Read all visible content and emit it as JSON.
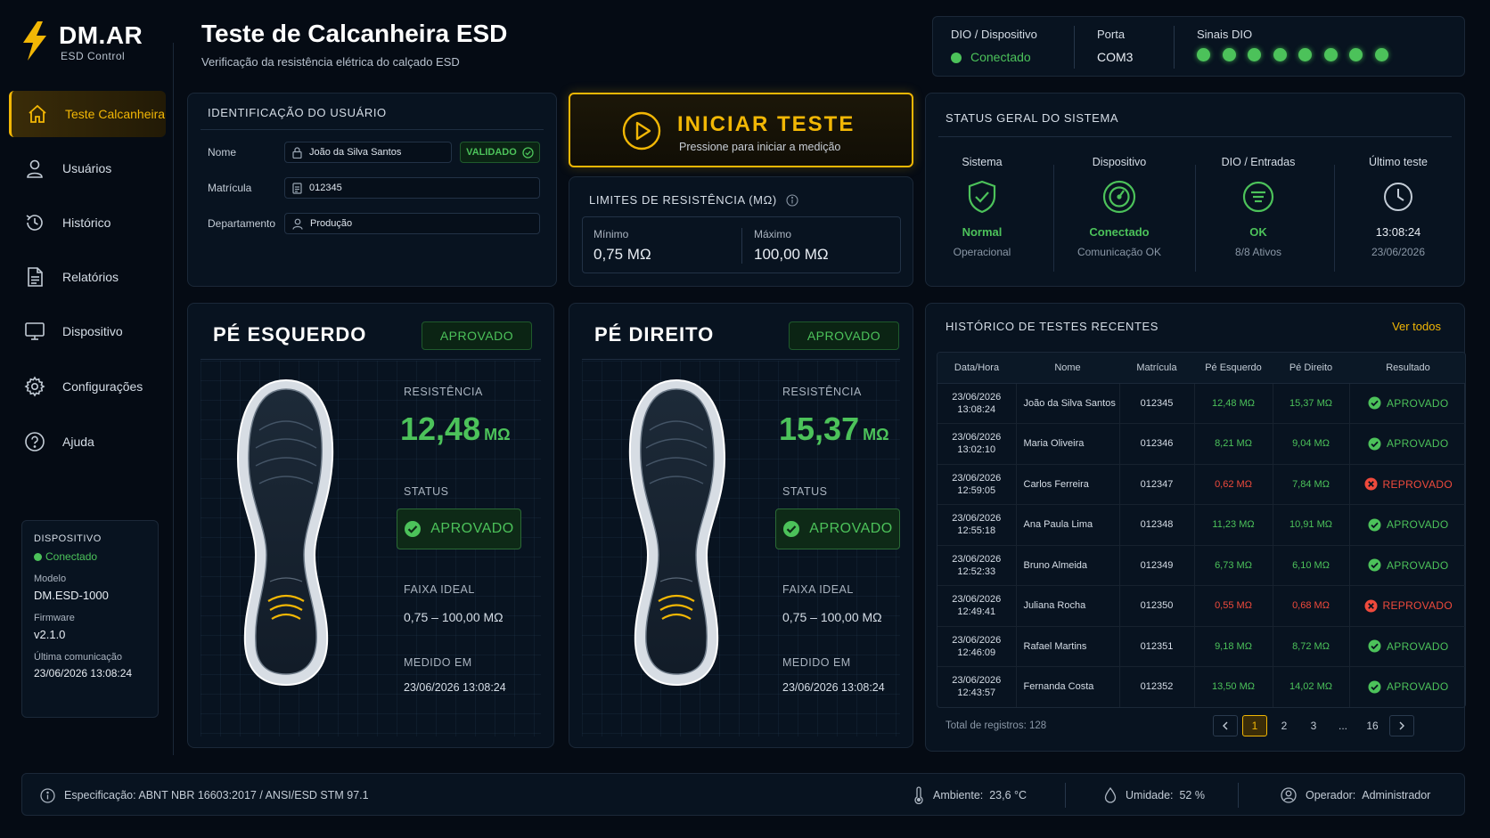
{
  "brand": {
    "name": "DM.AR",
    "sub": "ESD Control"
  },
  "nav": [
    {
      "label": "Teste Calcanheira",
      "icon": "home-icon",
      "active": true
    },
    {
      "label": "Usuários",
      "icon": "user-icon"
    },
    {
      "label": "Histórico",
      "icon": "history-icon"
    },
    {
      "label": "Relatórios",
      "icon": "report-icon"
    },
    {
      "label": "Dispositivo",
      "icon": "monitor-icon"
    },
    {
      "label": "Configurações",
      "icon": "gear-icon"
    },
    {
      "label": "Ajuda",
      "icon": "help-icon"
    }
  ],
  "device_card": {
    "title": "DISPOSITIVO",
    "status": "Conectado",
    "model_label": "Modelo",
    "model": "DM.ESD-1000",
    "firmware_label": "Firmware",
    "firmware": "v2.1.0",
    "last_comm_label": "Última comunicação",
    "last_comm": "23/06/2026 13:08:24"
  },
  "header": {
    "title": "Teste de Calcanheira ESD",
    "subtitle": "Verificação da resistência elétrica do calçado ESD"
  },
  "connection": {
    "dio_label": "DIO / Dispositivo",
    "dio_status": "Conectado",
    "port_label": "Porta",
    "port": "COM3",
    "signals_label": "Sinais DIO",
    "signals_active": 8
  },
  "user": {
    "section_title": "IDENTIFICAÇÃO DO USUÁRIO",
    "name_label": "Nome",
    "name": "João da Silva Santos",
    "validated": "VALIDADO",
    "id_label": "Matrícula",
    "id": "012345",
    "dept_label": "Departamento",
    "dept": "Produção"
  },
  "start": {
    "title": "INICIAR TESTE",
    "subtitle": "Pressione para iniciar a medição"
  },
  "limits": {
    "title": "LIMITES DE RESISTÊNCIA (MΩ)",
    "min_label": "Mínimo",
    "min": "0,75 MΩ",
    "max_label": "Máximo",
    "max": "100,00 MΩ"
  },
  "system": {
    "title": "STATUS GERAL DO SISTEMA",
    "cols": [
      {
        "title": "Sistema",
        "value": "Normal",
        "sub": "Operacional",
        "icon": "shield-check-icon"
      },
      {
        "title": "Dispositivo",
        "value": "Conectado",
        "sub": "Comunicação OK",
        "icon": "gauge-icon"
      },
      {
        "title": "DIO / Entradas",
        "value": "OK",
        "sub": "8/8 Ativos",
        "icon": "list-circle-icon"
      },
      {
        "title": "Último teste",
        "value": "13:08:24",
        "sub": "23/06/2026",
        "icon": "clock-icon"
      }
    ]
  },
  "left_foot": {
    "title": "PÉ ESQUERDO",
    "badge": "APROVADO",
    "resistance_label": "RESISTÊNCIA",
    "resistance": "12,48",
    "unit": "MΩ",
    "status_label": "STATUS",
    "status": "APROVADO",
    "range_label": "FAIXA IDEAL",
    "range": "0,75 – 100,00 MΩ",
    "measured_label": "MEDIDO EM",
    "measured": "23/06/2026 13:08:24"
  },
  "right_foot": {
    "title": "PÉ DIREITO",
    "badge": "APROVADO",
    "resistance_label": "RESISTÊNCIA",
    "resistance": "15,37",
    "unit": "MΩ",
    "status_label": "STATUS",
    "status": "APROVADO",
    "range_label": "FAIXA IDEAL",
    "range": "0,75 – 100,00 MΩ",
    "measured_label": "MEDIDO EM",
    "measured": "23/06/2026 13:08:24"
  },
  "history": {
    "title": "HISTÓRICO DE TESTES RECENTES",
    "view_all": "Ver todos",
    "columns": [
      "Data/Hora",
      "Nome",
      "Matrícula",
      "Pé Esquerdo",
      "Pé Direito",
      "Resultado"
    ],
    "rows": [
      {
        "date": "23/06/2026",
        "time": "13:08:24",
        "name": "João da Silva Santos",
        "id": "012345",
        "left": "12,48 MΩ",
        "right": "15,37 MΩ",
        "left_ok": true,
        "right_ok": true,
        "result": "APROVADO",
        "ok": true
      },
      {
        "date": "23/06/2026",
        "time": "13:02:10",
        "name": "Maria Oliveira",
        "id": "012346",
        "left": "8,21 MΩ",
        "right": "9,04 MΩ",
        "left_ok": true,
        "right_ok": true,
        "result": "APROVADO",
        "ok": true
      },
      {
        "date": "23/06/2026",
        "time": "12:59:05",
        "name": "Carlos Ferreira",
        "id": "012347",
        "left": "0,62 MΩ",
        "right": "7,84 MΩ",
        "left_ok": false,
        "right_ok": true,
        "result": "REPROVADO",
        "ok": false
      },
      {
        "date": "23/06/2026",
        "time": "12:55:18",
        "name": "Ana Paula Lima",
        "id": "012348",
        "left": "11,23 MΩ",
        "right": "10,91 MΩ",
        "left_ok": true,
        "right_ok": true,
        "result": "APROVADO",
        "ok": true
      },
      {
        "date": "23/06/2026",
        "time": "12:52:33",
        "name": "Bruno Almeida",
        "id": "012349",
        "left": "6,73 MΩ",
        "right": "6,10 MΩ",
        "left_ok": true,
        "right_ok": true,
        "result": "APROVADO",
        "ok": true
      },
      {
        "date": "23/06/2026",
        "time": "12:49:41",
        "name": "Juliana Rocha",
        "id": "012350",
        "left": "0,55 MΩ",
        "right": "0,68 MΩ",
        "left_ok": false,
        "right_ok": false,
        "result": "REPROVADO",
        "ok": false
      },
      {
        "date": "23/06/2026",
        "time": "12:46:09",
        "name": "Rafael Martins",
        "id": "012351",
        "left": "9,18 MΩ",
        "right": "8,72 MΩ",
        "left_ok": true,
        "right_ok": true,
        "result": "APROVADO",
        "ok": true
      },
      {
        "date": "23/06/2026",
        "time": "12:43:57",
        "name": "Fernanda Costa",
        "id": "012352",
        "left": "13,50 MΩ",
        "right": "14,02 MΩ",
        "left_ok": true,
        "right_ok": true,
        "result": "APROVADO",
        "ok": true
      }
    ],
    "total": "Total de registros: 128",
    "pages": [
      "1",
      "2",
      "3",
      "...",
      "16"
    ],
    "current_page": "1"
  },
  "footer": {
    "spec": "Especificação: ABNT NBR 16603:2017 / ANSI/ESD STM 97.1",
    "ambient_label": "Ambiente:",
    "ambient": "23,6 °C",
    "humidity_label": "Umidade:",
    "humidity": "52 %",
    "operator_label": "Operador:",
    "operator": "Administrador"
  },
  "colors": {
    "accent": "#f2b705",
    "ok": "#4cc25a",
    "fail": "#ef4a3c",
    "bg": "#050b14"
  }
}
